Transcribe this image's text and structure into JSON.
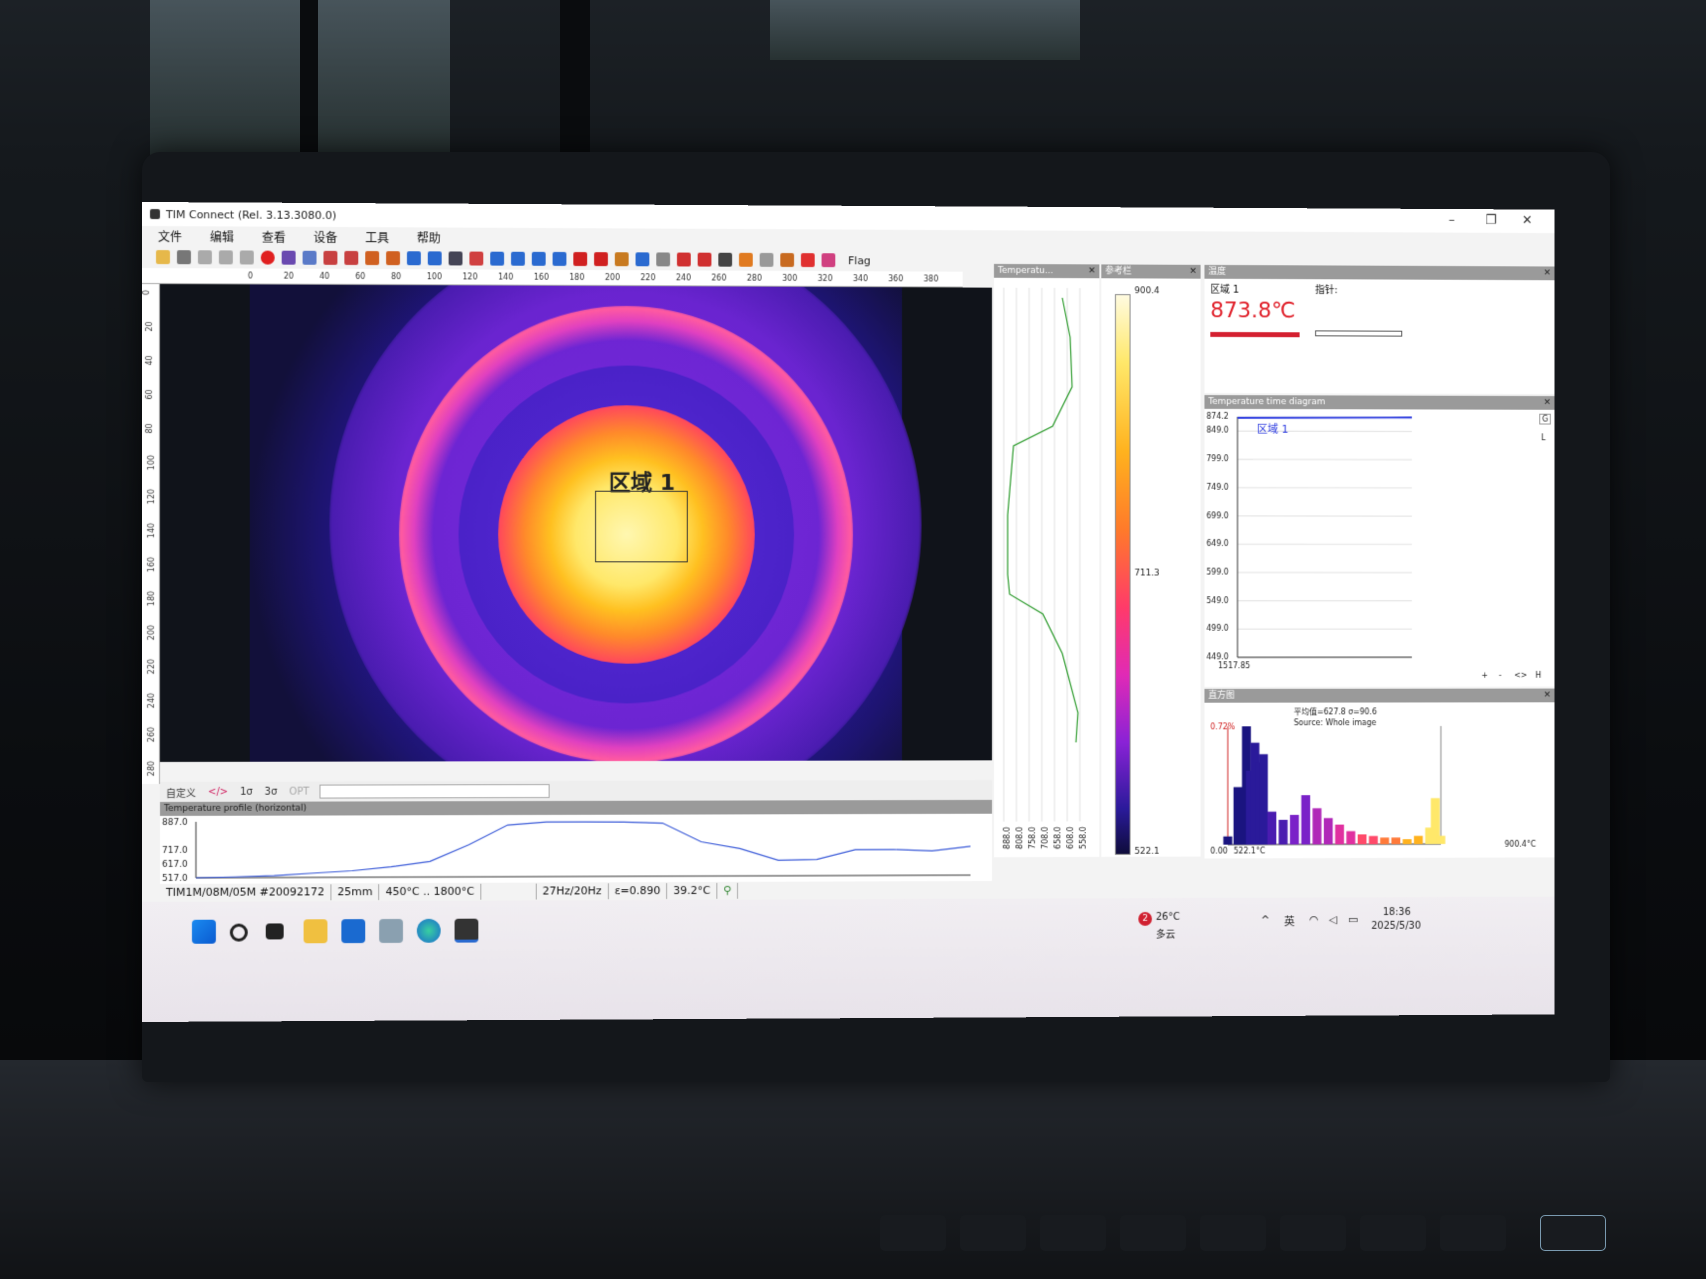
{
  "window": {
    "title": "TIM Connect (Rel. 3.13.3080.0)"
  },
  "menu": {
    "items": [
      "文件",
      "编辑",
      "查看",
      "设备",
      "工具",
      "帮助"
    ]
  },
  "toolbar": {
    "flag_label": "Flag"
  },
  "rulers": {
    "horizontal_ticks": [
      "0",
      "20",
      "40",
      "60",
      "80",
      "100",
      "120",
      "140",
      "160",
      "180",
      "200",
      "220",
      "240",
      "260",
      "280",
      "300",
      "320",
      "340",
      "360",
      "380"
    ],
    "vertical_ticks": [
      "0",
      "20",
      "40",
      "60",
      "80",
      "100",
      "120",
      "140",
      "160",
      "180",
      "200",
      "220",
      "240",
      "260",
      "280"
    ]
  },
  "image": {
    "zone_label": "区域 1"
  },
  "lower_tabs": {
    "items": [
      "自定义",
      "</>",
      "1σ",
      "3σ",
      "OPT"
    ]
  },
  "profile": {
    "title": "Temperature profile (horizontal)",
    "y_ticks": [
      "887.0",
      "717.0",
      "617.0",
      "517.0"
    ]
  },
  "status": {
    "device": "TIM1M/08M/05M #20092172",
    "lens": "25mm",
    "range": "450°C .. 1800°C",
    "framerate": "27Hz/20Hz",
    "emissivity": "ε=0.890",
    "ambient": "39.2°C"
  },
  "panels": {
    "temp_profile_title": "Temperatu...",
    "colorbar_title": "参考栏",
    "measure_title": "温度",
    "ttd_title": "Temperature time diagram",
    "hist_title": "直方图"
  },
  "vprofile": {
    "x_ticks": [
      "888.0",
      "808.0",
      "758.0",
      "708.0",
      "658.0",
      "608.0",
      "558.0"
    ]
  },
  "colorbar": {
    "max": "900.4",
    "mid": "711.3",
    "min": "522.1"
  },
  "measure": {
    "zone_name": "区域 1",
    "value": "873.8℃",
    "pointer_label": "指针:"
  },
  "ttd": {
    "y_ticks": [
      "874.2",
      "849.0",
      "799.0",
      "749.0",
      "699.0",
      "649.0",
      "599.0",
      "549.0",
      "499.0",
      "449.0"
    ],
    "x_label": "1517.85",
    "legend": "区域 1",
    "side_g": "G",
    "side_l": "L",
    "bottom_controls": [
      "+",
      "-",
      "<>",
      "H"
    ]
  },
  "hist": {
    "stats": "平均值=627.8 σ=90.6",
    "source": "Source: Whole image",
    "pct": "0.72%",
    "x_left": "0.00",
    "x_min": "522.1°C",
    "x_max": "900.4°C"
  },
  "taskbar": {
    "weather_temp": "26°C",
    "weather_desc": "多云",
    "weather_badge": "2",
    "ime": "英",
    "time": "18:36",
    "date": "2025/5/30"
  },
  "colors": {
    "accent_red": "#e0202a",
    "ttd_line": "#2b3ae0"
  },
  "chart_data": [
    {
      "type": "line",
      "title": "Temperature profile (horizontal)",
      "xlabel": "",
      "ylabel": "",
      "ylim": [
        517,
        887
      ],
      "x": [
        0,
        5,
        10,
        15,
        20,
        25,
        30,
        35,
        40,
        45,
        50,
        55,
        60,
        65,
        70,
        75,
        80,
        85,
        90,
        95,
        100
      ],
      "values": [
        517,
        522,
        530,
        545,
        560,
        585,
        620,
        730,
        860,
        880,
        880,
        878,
        870,
        745,
        700,
        620,
        625,
        690,
        690,
        680,
        710
      ]
    },
    {
      "type": "line",
      "title": "Temperature time diagram",
      "xlabel": "1517.85",
      "ylabel": "",
      "ylim": [
        449,
        874.2
      ],
      "series": [
        {
          "name": "区域 1",
          "x": [
            0,
            100
          ],
          "values": [
            872.5,
            873.8
          ]
        }
      ]
    },
    {
      "type": "bar",
      "title": "直方图",
      "xlabel": "",
      "ylabel": "",
      "x": [
        522,
        540,
        555,
        562,
        570,
        578,
        585,
        600,
        620,
        640,
        660,
        680,
        700,
        720,
        740,
        760,
        780,
        800,
        820,
        840,
        860,
        880,
        890,
        900
      ],
      "values": [
        0.05,
        0.35,
        0.72,
        0.45,
        0.62,
        0.5,
        0.55,
        0.2,
        0.15,
        0.18,
        0.3,
        0.22,
        0.16,
        0.12,
        0.08,
        0.06,
        0.05,
        0.04,
        0.04,
        0.03,
        0.05,
        0.1,
        0.28,
        0.05
      ]
    }
  ]
}
